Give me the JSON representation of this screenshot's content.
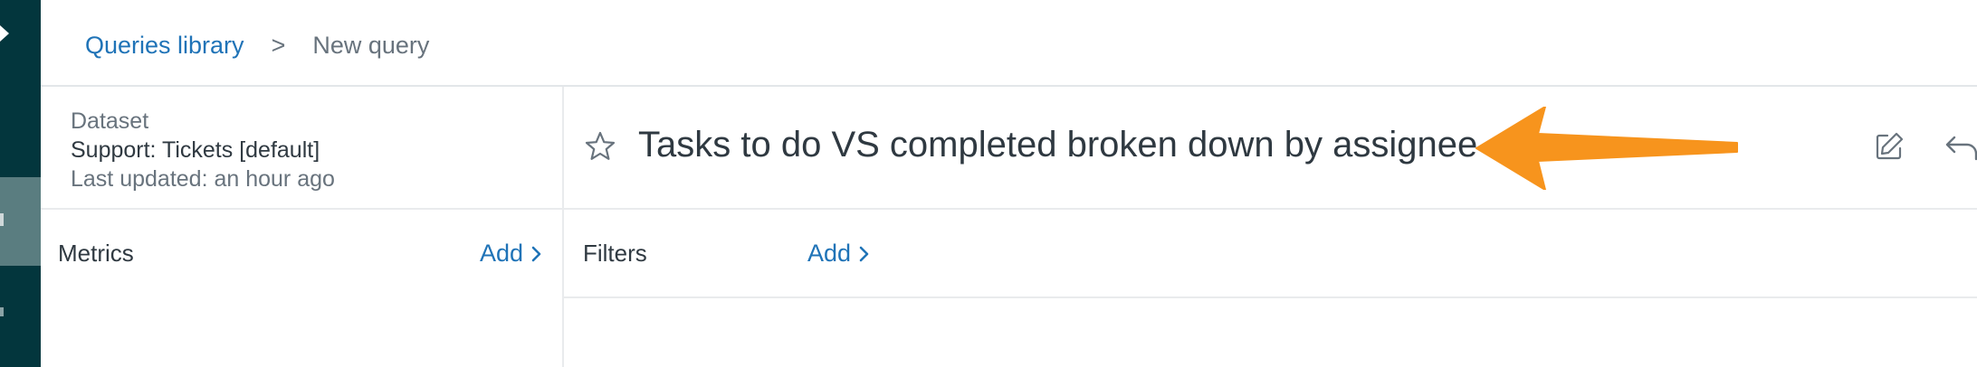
{
  "breadcrumb": {
    "library_label": "Queries library",
    "separator": ">",
    "current_label": "New query"
  },
  "dataset": {
    "label": "Dataset",
    "name": "Support: Tickets [default]",
    "updated": "Last updated: an hour ago"
  },
  "metrics": {
    "label": "Metrics",
    "add_label": "Add"
  },
  "query": {
    "title": "Tasks to do VS completed broken down by assignee"
  },
  "filters": {
    "label": "Filters",
    "add_label": "Add"
  },
  "icons": {
    "star": "star-icon",
    "edit": "edit-icon",
    "undo": "undo-icon",
    "chevron": "chevron-right-icon",
    "annotation": "orange-arrow-annotation"
  },
  "colors": {
    "rail": "#03363d",
    "rail_active": "#5a7d80",
    "link": "#1f73b7",
    "annotation_arrow": "#f7941d"
  }
}
